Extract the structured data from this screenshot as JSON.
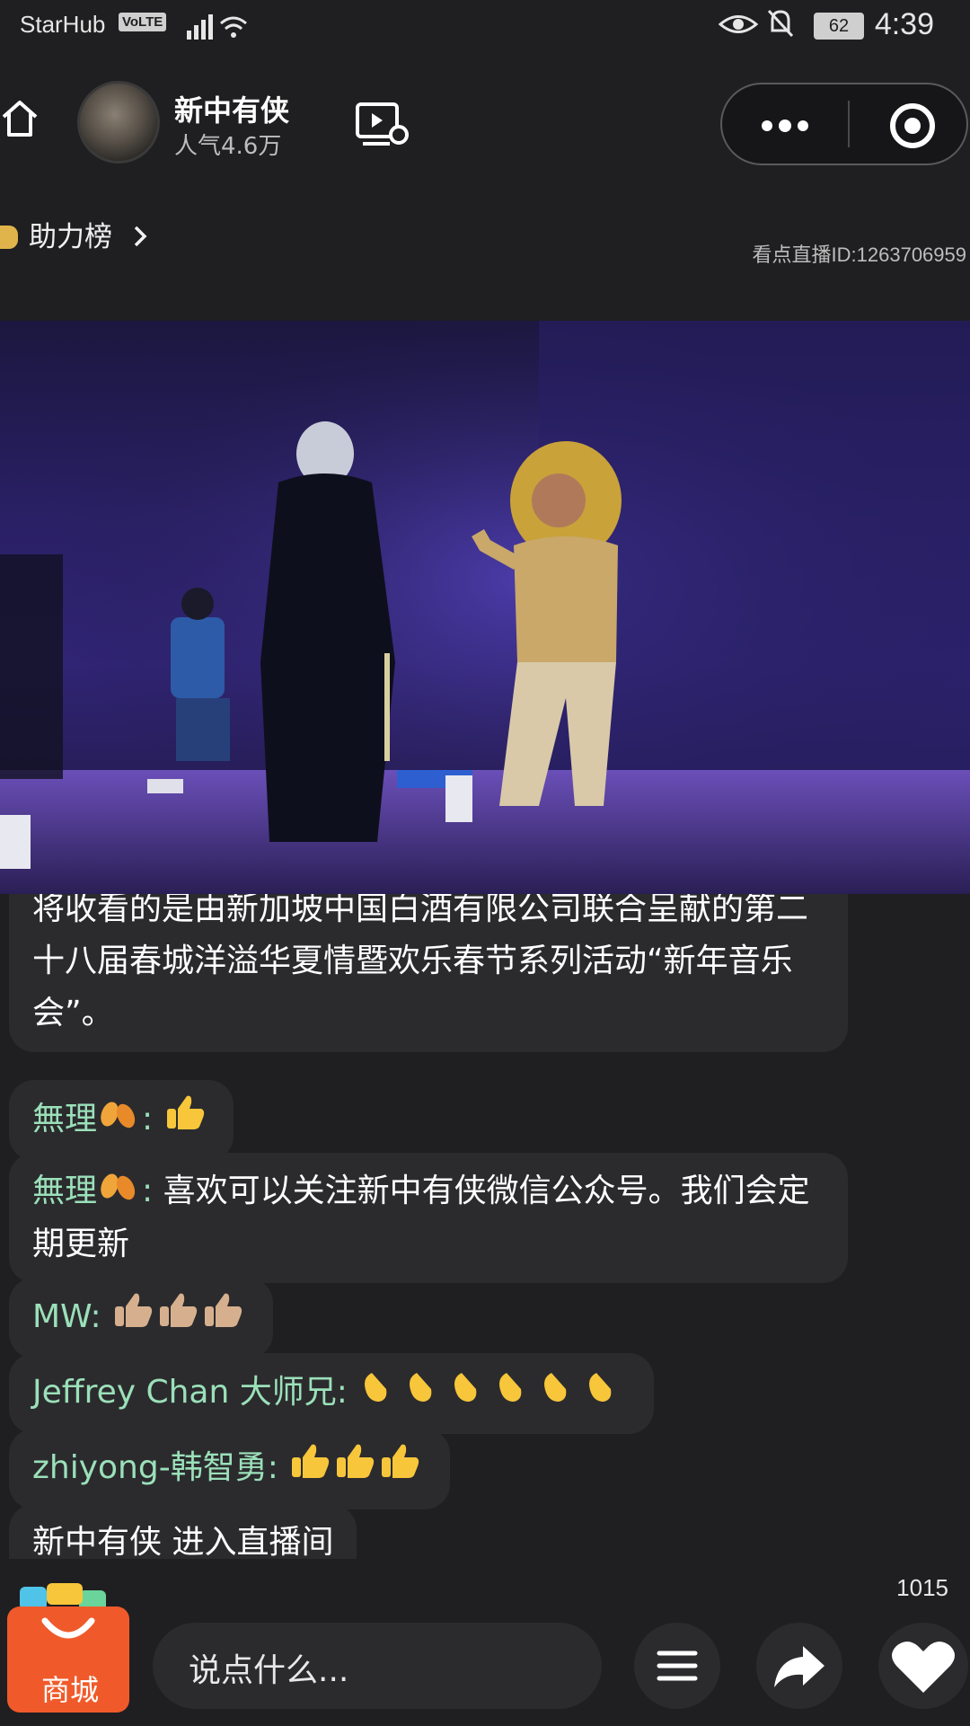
{
  "status_bar": {
    "carrier": "StarHub",
    "network_badge": "VoLTE",
    "battery": "62",
    "time": "4:39"
  },
  "header": {
    "channel_name": "新中有侠",
    "popularity": "人气4.6万",
    "boost_label": "助力榜",
    "live_id": "看点直播ID:1263706959"
  },
  "chat": {
    "messages": [
      {
        "user": "",
        "text": "将收看的是由新加坡中国白酒有限公司联合呈献的第二十八届春城洋溢华夏情暨欢乐春节系列活动“新年音乐会”。"
      },
      {
        "user": "無理",
        "sep": ": ",
        "text": ""
      },
      {
        "user": "無理",
        "sep": ": ",
        "text": "喜欢可以关注新中有侠微信公众号。我们会定期更新"
      },
      {
        "user": "MW",
        "sep": ": ",
        "text": ""
      },
      {
        "user": "Jeffrey  Chan  大师兄",
        "sep": ": ",
        "text": ""
      },
      {
        "user": "zhiyong-韩智勇",
        "sep": ": ",
        "text": ""
      },
      {
        "user": "",
        "text": "新中有侠 进入直播间"
      }
    ]
  },
  "bottom_bar": {
    "shop_label": "商城",
    "comment_placeholder": "说点什么...",
    "like_count": "1015"
  },
  "icons": [
    "home-icon",
    "replay-icon",
    "more-dots-icon",
    "target-icon",
    "medal-icon",
    "chevron-right-icon",
    "menu-icon",
    "share-arrow-icon",
    "heart-icon",
    "thumbs-up-emoji",
    "clap-emoji",
    "leaf-emoji"
  ],
  "colors": {
    "background": "#1f1f21",
    "bubble": "#2b2b2e",
    "username": "#9be0b9",
    "shop": "#f05a2a"
  }
}
